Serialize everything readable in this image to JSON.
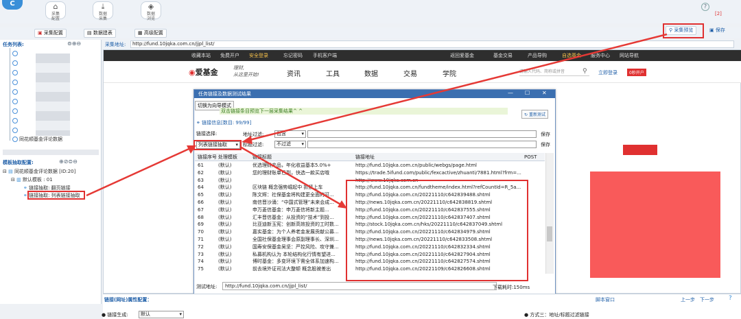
{
  "toolbar": {
    "logo": "C",
    "buttons": [
      {
        "label_top": "采集",
        "label_bot": "配置",
        "icon": "home-icon"
      },
      {
        "label_top": "数据",
        "label_bot": "采集",
        "icon": "download-icon"
      },
      {
        "label_top": "数据",
        "label_bot": "浏览",
        "icon": "layers-icon"
      }
    ],
    "help_badge": "[2]",
    "preview_label": "采集预览",
    "save_label": "保存"
  },
  "subtabs": [
    "采集配置",
    "数据建表",
    "高级配置"
  ],
  "left": {
    "task_list_title": "任务列表:",
    "task_last": "同花顺基金评论数据",
    "template_title": "模板抽取配置:",
    "tree": [
      "同花顺基金评论数据 [ID:20]",
      "默认模板 : 01",
      "链接抽取: 翻页链接",
      "链接抽取: 列表链接抽取"
    ]
  },
  "address": {
    "label": "采集地址:",
    "value": "http://fund.10jqka.com.cn/jjpl_list/"
  },
  "site": {
    "nav": [
      "收藏本站",
      "免费开户",
      "安全登录",
      "忘记密码",
      "手机客户端",
      "返回爱基金",
      "基金交易",
      "产品导购",
      "自选基金",
      "服务中心",
      "网站导航"
    ],
    "brand": "爱基金",
    "slogan1": "理财,",
    "slogan2": "从这里开始!",
    "menu": [
      "资讯",
      "工具",
      "数据",
      "交易",
      "学院"
    ],
    "search_placeholder": "请输入代码、简称或拼音",
    "login": "立即登录",
    "open_account": "0秒开户"
  },
  "dialog": {
    "title": "任务链接及数据测试结果",
    "switch_btn": "切换为向导模式",
    "hint": "双击链接条目预览下一层采集结果^ ^",
    "retest": "重新测试",
    "link_info": "链接信息[数目: 99/99]",
    "link_select_label": "链接选择:",
    "link_select_value": "列表链接抽取",
    "addr_filter_label": "地址过滤:",
    "addr_filter_value": "包含",
    "title_filter_label": "标题过滤:",
    "title_filter_value": "不过滤",
    "save1": "保存",
    "save2": "保存",
    "columns": [
      "链接序号",
      "处理模板",
      "链接标题",
      "链接地址",
      "POST"
    ],
    "rows": [
      [
        "61",
        "(默认)",
        "优选理财产品，年化收益基本5.0%+",
        "http://fund.10jqka.com.cn/public/webgs/page.html"
      ],
      [
        "62",
        "(默认)",
        "您的理财账单已到，快选一款买店哦",
        "https://trade.5ifund.com/public/fexcactive/zhuanti/7881.html?frm=..."
      ],
      [
        "63",
        "(默认)",
        "",
        "http://www.10jqka.com.cn"
      ],
      [
        "64",
        "(默认)",
        "区块链 概念强势崛起中 抓紧上车",
        "http://fund.10jqka.com.cn/fundtheme/index.html?refCountId=R_5a..."
      ],
      [
        "65",
        "(默认)",
        "陈文辉：社保基金将构建更全面的可...",
        "http://fund.10jqka.com.cn/20221110/c642839488.shtml"
      ],
      [
        "66",
        "(默认)",
        "南信晋沙涌：“中国式管理”未来会成...",
        "http://news.10jqka.com.cn/20221110/c642838819.shtml"
      ],
      [
        "67",
        "(默认)",
        "申万菱信基金：申万菱信将新主题...",
        "http://fund.10jqka.com.cn/20221110/c642837555.shtml"
      ],
      [
        "68",
        "(默认)",
        "汇丰晋信基金：从投资的“技术”到投...",
        "http://fund.10jqka.com.cn/20221110/c642837407.shtml"
      ],
      [
        "69",
        "(默认)",
        "比亚迪新玉宪：创新高效投资的工时数...",
        "http://stock.10jqka.com.cn/hks/20221110/c642837049.shtml"
      ],
      [
        "70",
        "(默认)",
        "嘉实基金：为个人养老金发展贡献公募...",
        "http://fund.10jqka.com.cn/20221110/c642834979.shtml"
      ],
      [
        "71",
        "(默认)",
        "全国社保基金理事会原副理事长、深圳...",
        "http://news.10jqka.com.cn/20221110/c642833508.shtml"
      ],
      [
        "72",
        "(默认)",
        "国寿安保基金吴坚：严控风险、攻守兼...",
        "http://fund.10jqka.com.cn/20221110/c642832334.shtml"
      ],
      [
        "73",
        "(默认)",
        "私募机构认为 本轮结构化行情有望进...",
        "http://fund.10jqka.com.cn/20221110/c642827904.shtml"
      ],
      [
        "74",
        "(默认)",
        "博时基金：多变环境下需全体系加速构...",
        "http://fund.10jqka.com.cn/20221110/c642827574.shtml"
      ],
      [
        "75",
        "(默认)",
        "前去境外证司法大整顿 概念股被差出",
        "http://fund.10jqka.com.cn/20221109/c642826608.shtml"
      ]
    ],
    "test_addr_label": "测试地址:",
    "test_addr_value": "http://fund.10jqka.com.cn/jjpl_list/",
    "elapsed": "下载耗时:150ms"
  },
  "bottom": {
    "section_title": "链接(网址)属性配置：",
    "script_window": "脚本窗口",
    "prev": "上一步",
    "next": "下一步",
    "link_gen_label": "链接生成:",
    "link_gen_value": "默认",
    "method": "方式三：地址/标题过滤链接"
  },
  "colors": {
    "accent": "#3a8fd8",
    "highlight": "#e03030",
    "site_red": "#f95a5a"
  }
}
